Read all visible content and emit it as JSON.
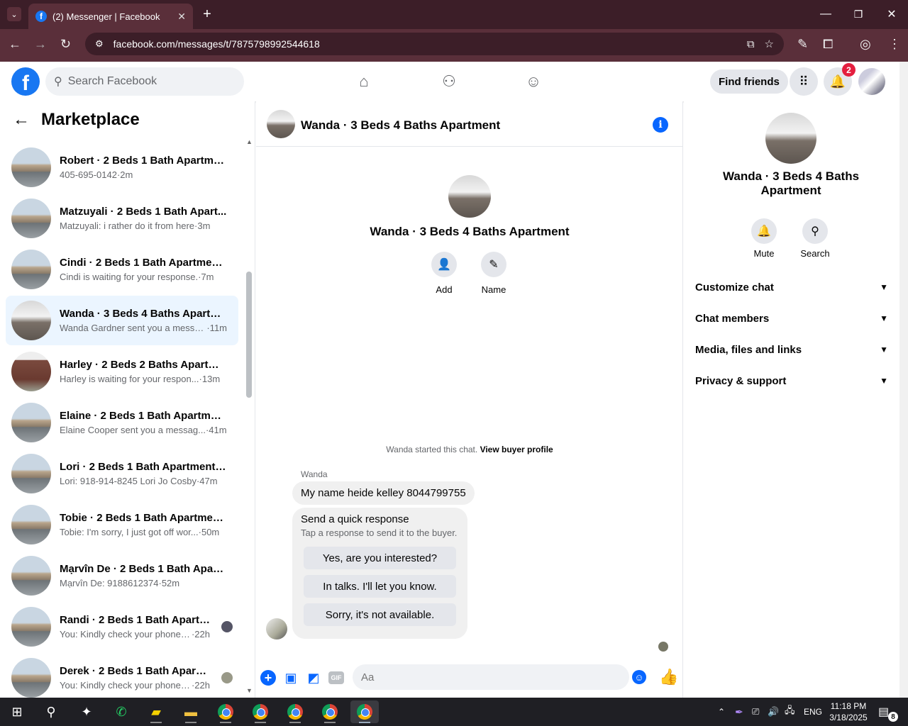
{
  "browser": {
    "tab_title": "(2) Messenger | Facebook",
    "url": "facebook.com/messages/t/7875798992544618"
  },
  "fb": {
    "search_placeholder": "Search Facebook",
    "find_friends": "Find friends",
    "notifications_count": "2"
  },
  "left": {
    "title": "Marketplace",
    "conversations": [
      {
        "name": "Robert · 2 Beds 1 Bath Apartmen...",
        "snippet": "405-695-0142",
        "time": "·2m"
      },
      {
        "name": "Matzuyali · 2 Beds 1 Bath Apart...",
        "snippet": "Matzuyali: i rather do it from here",
        "time": "·3m"
      },
      {
        "name": "Cindi · 2 Beds 1 Bath Apartment...",
        "snippet": "Cindi is waiting for your response.",
        "time": "·7m"
      },
      {
        "name": "Wanda · 3 Beds 4 Baths Apartm...",
        "snippet": "Wanda Gardner sent you a messa...",
        "time": "·11m"
      },
      {
        "name": "Harley · 2 Beds 2 Baths Apartme...",
        "snippet": "Harley is waiting for your respon...",
        "time": "·13m"
      },
      {
        "name": "Elaine · 2 Beds 1 Bath Apartment...",
        "snippet": "Elaine Cooper sent you a messag...",
        "time": "·41m"
      },
      {
        "name": "Lori · 2 Beds 1 Bath Apartment/c...",
        "snippet": "Lori: 918-914-8245 Lori Jo Cosby",
        "time": "·47m"
      },
      {
        "name": "Tobie · 2 Beds 1 Bath Apartment...",
        "snippet": "Tobie: I'm sorry, I just got off wor...",
        "time": "·50m"
      },
      {
        "name": "Mạrvîn De · 2 Beds 1 Bath Apart...",
        "snippet": "Mạrvîn De: 9188612374",
        "time": "·52m"
      },
      {
        "name": "Randi · 2 Beds 1 Bath Apartme...",
        "snippet": "You: Kindly check your phone a...",
        "time": "·22h"
      },
      {
        "name": "Derek · 2 Beds 1 Bath Apartm...",
        "snippet": "You: Kindly check your phone a...",
        "time": "·22h"
      }
    ]
  },
  "chat": {
    "title": "Wanda · 3 Beds 4 Baths Apartment",
    "profile_name": "Wanda · 3 Beds 4 Baths Apartment",
    "add_label": "Add",
    "name_label": "Name",
    "started_text": "Wanda started this chat.",
    "view_profile": "View buyer profile",
    "sender": "Wanda",
    "message": "My name heide kelley 8044799755",
    "quick_title": "Send a quick response",
    "quick_sub": "Tap a response to send it to the buyer.",
    "quick_options": [
      "Yes, are you interested?",
      "In talks. I'll let you know.",
      "Sorry, it's not available."
    ],
    "input_placeholder": "Aa"
  },
  "right": {
    "name": "Wanda · 3 Beds 4 Baths Apartment",
    "mute": "Mute",
    "search": "Search",
    "sections": [
      "Customize chat",
      "Chat members",
      "Media, files and links",
      "Privacy & support"
    ]
  },
  "taskbar": {
    "lang": "ENG",
    "time": "11:18 PM",
    "date": "3/18/2025",
    "notif_count": "8"
  }
}
